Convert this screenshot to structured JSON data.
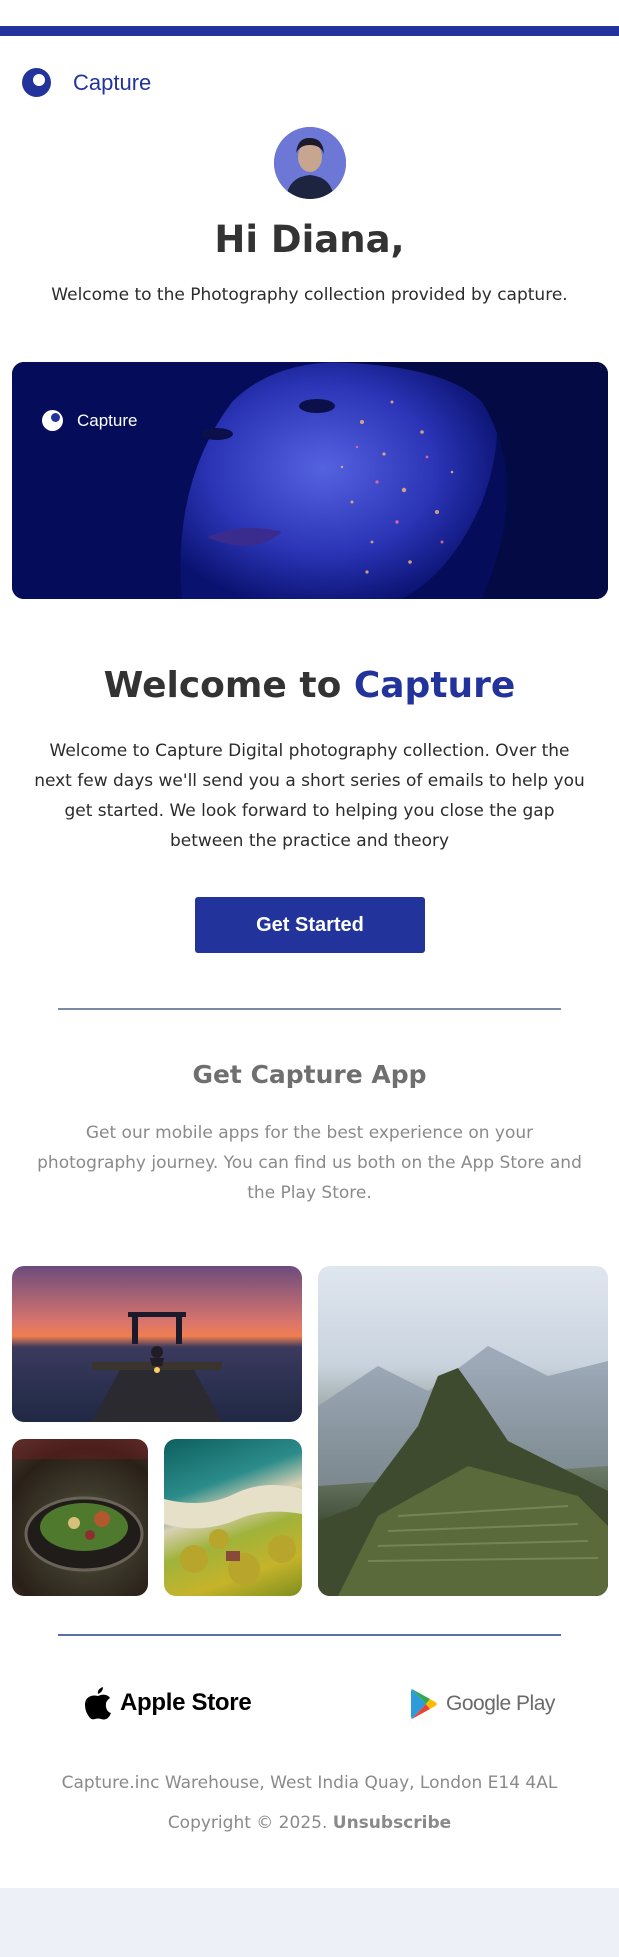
{
  "brand": {
    "name": "Capture",
    "accent_color": "#22349c",
    "logo_icon": "capture-logo-icon"
  },
  "header": {
    "greeting": "Hi Diana,",
    "intro": "Welcome to the Photography collection provided by capture."
  },
  "hero": {
    "brand_name": "Capture",
    "image": "portrait-glitter-blue"
  },
  "welcome": {
    "title_prefix": "Welcome to",
    "title_accent": "Capture",
    "body": "Welcome to Capture Digital photography collection. Over the next few days we'll send you a short series of emails to help you get started. We look forward to helping you close the gap between the practice and theory",
    "cta_label": "Get Started"
  },
  "app_section": {
    "title": "Get Capture App",
    "body": "Get our mobile apps for the best experience on your photography journey. You can find us both on the App Store and the Play Store."
  },
  "gallery": [
    {
      "name": "sunset-pier-photo"
    },
    {
      "name": "mountain-ruins-photo"
    },
    {
      "name": "salad-bowl-photo"
    },
    {
      "name": "aerial-coast-photo"
    }
  ],
  "stores": {
    "apple_label": "Apple Store",
    "google_label": "Google Play"
  },
  "footer": {
    "address": "Capture.inc Warehouse, West India Quay, London E14 4AL",
    "copyright": "Copyright © 2025.",
    "unsubscribe": "Unsubscribe"
  }
}
